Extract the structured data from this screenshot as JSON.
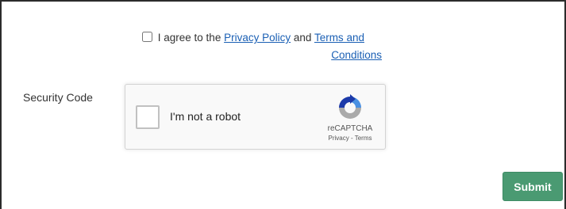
{
  "agreement": {
    "checked": false,
    "prefix": "I agree to the",
    "privacy_link": "Privacy Policy",
    "conjunction": "and",
    "terms_link_line1": "Terms and",
    "terms_link_line2": "Conditions"
  },
  "security": {
    "label": "Security Code"
  },
  "recaptcha": {
    "label": "I'm not a robot",
    "brand": "reCAPTCHA",
    "privacy": "Privacy",
    "separator": "-",
    "terms": "Terms",
    "icon": "recaptcha-logo-icon"
  },
  "submit": {
    "label": "Submit",
    "color": "#4a9a72"
  },
  "colors": {
    "link": "#1a5fb4",
    "frame_border": "#2b2b2b"
  }
}
